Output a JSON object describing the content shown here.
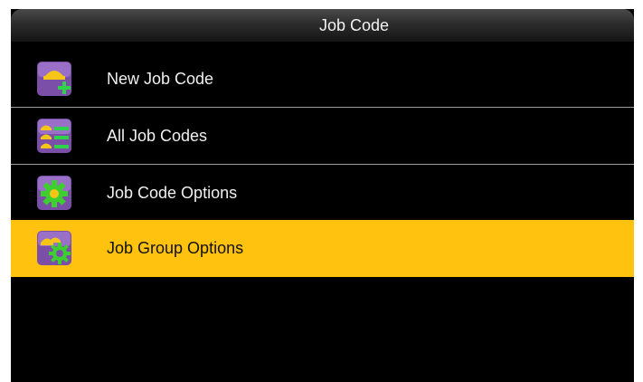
{
  "window": {
    "title": "Job Code"
  },
  "menu": {
    "items": [
      {
        "label": "New Job Code",
        "icon": "add-job-code-icon",
        "selected": false
      },
      {
        "label": "All Job Codes",
        "icon": "job-code-list-icon",
        "selected": false
      },
      {
        "label": "Job Code Options",
        "icon": "gear-icon",
        "selected": false
      },
      {
        "label": "Job Group Options",
        "icon": "group-gear-icon",
        "selected": true
      }
    ]
  },
  "colors": {
    "background": "#000000",
    "title_bar": "#2c2c2c",
    "highlight": "#ffc20e",
    "icon_tile": "#7b4fa8"
  }
}
